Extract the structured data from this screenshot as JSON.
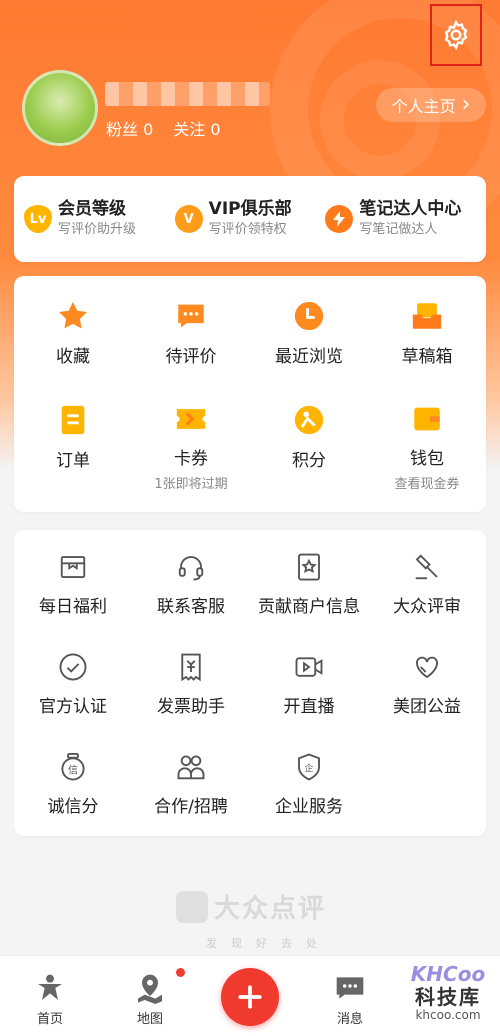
{
  "profile": {
    "fans_label": "粉丝 0",
    "follow_label": "关注 0",
    "homepage_btn": "个人主页",
    "homepage_arrow": "›"
  },
  "member": [
    {
      "title": "会员等级",
      "sub": "写评价助升级",
      "badge": "Lv",
      "color": "#ffb400"
    },
    {
      "title": "VIP俱乐部",
      "sub": "写评价领特权",
      "badge": "V",
      "color": "#ff9c1a"
    },
    {
      "title": "笔记达人中心",
      "sub": "写笔记做达人",
      "badge": "",
      "color": "#ff7a1a"
    }
  ],
  "quick": [
    {
      "label": "收藏",
      "sub": "",
      "icon": "star-icon"
    },
    {
      "label": "待评价",
      "sub": "",
      "icon": "comment-icon"
    },
    {
      "label": "最近浏览",
      "sub": "",
      "icon": "clock-icon"
    },
    {
      "label": "草稿箱",
      "sub": "",
      "icon": "drafts-icon"
    },
    {
      "label": "订单",
      "sub": "",
      "icon": "order-icon"
    },
    {
      "label": "卡券",
      "sub": "1张即将过期",
      "icon": "coupon-icon"
    },
    {
      "label": "积分",
      "sub": "",
      "icon": "points-icon"
    },
    {
      "label": "钱包",
      "sub": "查看现金券",
      "icon": "wallet-icon"
    }
  ],
  "services": [
    {
      "label": "每日福利",
      "icon": "gift-box-icon"
    },
    {
      "label": "联系客服",
      "icon": "headset-icon"
    },
    {
      "label": "贡献商户信息",
      "icon": "merchant-icon"
    },
    {
      "label": "大众评审",
      "icon": "gavel-icon"
    },
    {
      "label": "官方认证",
      "icon": "check-circle-icon"
    },
    {
      "label": "发票助手",
      "icon": "invoice-icon"
    },
    {
      "label": "开直播",
      "icon": "live-video-icon"
    },
    {
      "label": "美团公益",
      "icon": "charity-heart-icon"
    },
    {
      "label": "诚信分",
      "icon": "credit-icon"
    },
    {
      "label": "合作/招聘",
      "icon": "people-icon"
    },
    {
      "label": "企业服务",
      "icon": "enterprise-shield-icon"
    }
  ],
  "brand": {
    "name": "大众点评",
    "slogan": "发现好去处"
  },
  "tabs": {
    "home": "首页",
    "map": "地图",
    "messages": "消息"
  },
  "watermark": {
    "top": "KHCoo",
    "mid": "科技库",
    "bot": "khcoo.com"
  },
  "colors": {
    "accent": "#ff7a32",
    "red": "#f03a2e",
    "orange_icon": "#ff8a1f",
    "yellow_icon": "#ffb400"
  }
}
